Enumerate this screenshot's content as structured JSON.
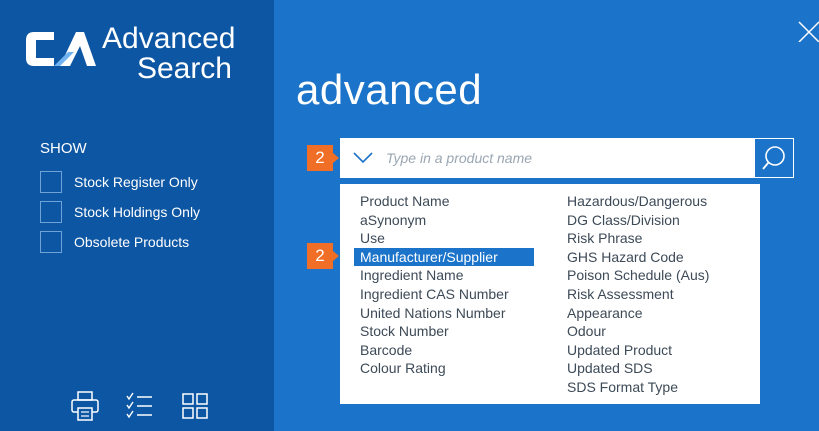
{
  "sidebar": {
    "logo_text": "CA",
    "title_line1": "Advanced",
    "title_line2": "Search",
    "show_label": "SHOW",
    "filters": [
      {
        "label": "Stock Register Only",
        "checked": false
      },
      {
        "label": "Stock Holdings Only",
        "checked": false
      },
      {
        "label": "Obsolete Products",
        "checked": false
      }
    ],
    "footer_icons": [
      "print-icon",
      "checklist-icon",
      "grid-icon"
    ]
  },
  "main": {
    "title": "advanced",
    "search": {
      "placeholder": "Type in a product name",
      "value": ""
    },
    "badges": [
      "2",
      "2"
    ],
    "dropdown": {
      "left_column": [
        "Product Name",
        "aSynonym",
        "Use",
        "Manufacturer/Supplier",
        "Ingredient Name",
        "Ingredient CAS Number",
        "United Nations Number",
        "Stock Number",
        "Barcode",
        "Colour Rating"
      ],
      "right_column": [
        "Hazardous/Dangerous",
        "DG Class/Division",
        "Risk Phrase",
        "GHS Hazard Code",
        "Poison Schedule (Aus)",
        "Risk Assessment",
        "Appearance",
        "Odour",
        "Updated Product",
        "Updated SDS",
        "SDS Format Type"
      ],
      "selected": "Manufacturer/Supplier"
    }
  },
  "colors": {
    "sidebar_bg": "#0d56a3",
    "main_bg": "#1b74c9",
    "badge": "#f06e26",
    "highlight": "#1b74c9"
  }
}
